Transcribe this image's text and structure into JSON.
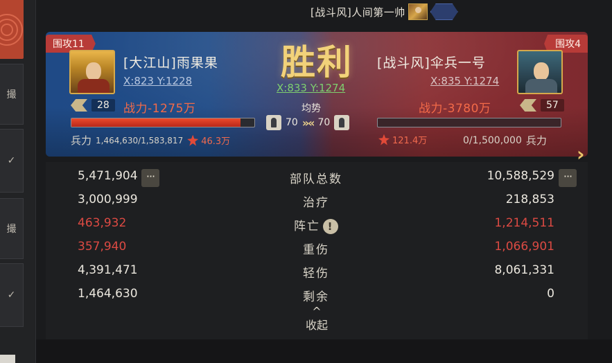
{
  "header": {
    "title": "[战斗风]人间第一帅",
    "avatar_icon": "general-portrait-icon",
    "badge_icon": "hexagon-badge-icon"
  },
  "left_sidebar": {
    "panels": [
      "撮",
      "✓",
      "撮",
      "✓"
    ]
  },
  "battle": {
    "result": "胜利",
    "center_coord": "X:833 Y:1274",
    "balance_label": "均势",
    "attacker": {
      "siege_tag": "围攻11",
      "name": "[大江山]雨果果",
      "coord": "X:823 Y:1228",
      "level": "28",
      "power": "战力-1275万",
      "morale": "70",
      "troops_label": "兵力",
      "troops": "1,464,630/1,583,817",
      "troops_fraction": 0.925,
      "hurt": "46.3万"
    },
    "defender": {
      "siege_tag": "围攻4",
      "name": "[战斗风]伞兵一号",
      "coord": "X:835 Y:1274",
      "level": "57",
      "power": "战力-3780万",
      "morale": "70",
      "troops_label": "兵力",
      "troops": "0/1,500,000",
      "troops_fraction": 0,
      "hurt": "121.4万"
    },
    "vs_arrows": "»«"
  },
  "stats": {
    "rows": [
      {
        "label": "部队总数",
        "left": "5,471,904",
        "right": "10,588,529",
        "left_color": "white",
        "right_color": "white"
      },
      {
        "label": "治疗",
        "left": "3,000,999",
        "right": "218,853",
        "left_color": "white",
        "right_color": "white"
      },
      {
        "label": "阵亡",
        "left": "463,932",
        "right": "1,214,511",
        "left_color": "red",
        "right_color": "red"
      },
      {
        "label": "重伤",
        "left": "357,940",
        "right": "1,066,901",
        "left_color": "red",
        "right_color": "red"
      },
      {
        "label": "轻伤",
        "left": "4,391,471",
        "right": "8,061,331",
        "left_color": "white",
        "right_color": "white"
      },
      {
        "label": "剩余",
        "left": "1,464,630",
        "right": "0",
        "left_color": "white",
        "right_color": "white"
      }
    ],
    "more_label": "···",
    "info_label": "!",
    "collapse_label": "收起",
    "collapse_arrow": "^"
  },
  "colors": {
    "attacker_side": "#1f4a86",
    "defender_side": "#8a2f33",
    "victory_gold": "#f2d27a",
    "power_red": "#f36a48",
    "loss_red": "#dc4a43",
    "coord_green": "#7fcf6e"
  }
}
